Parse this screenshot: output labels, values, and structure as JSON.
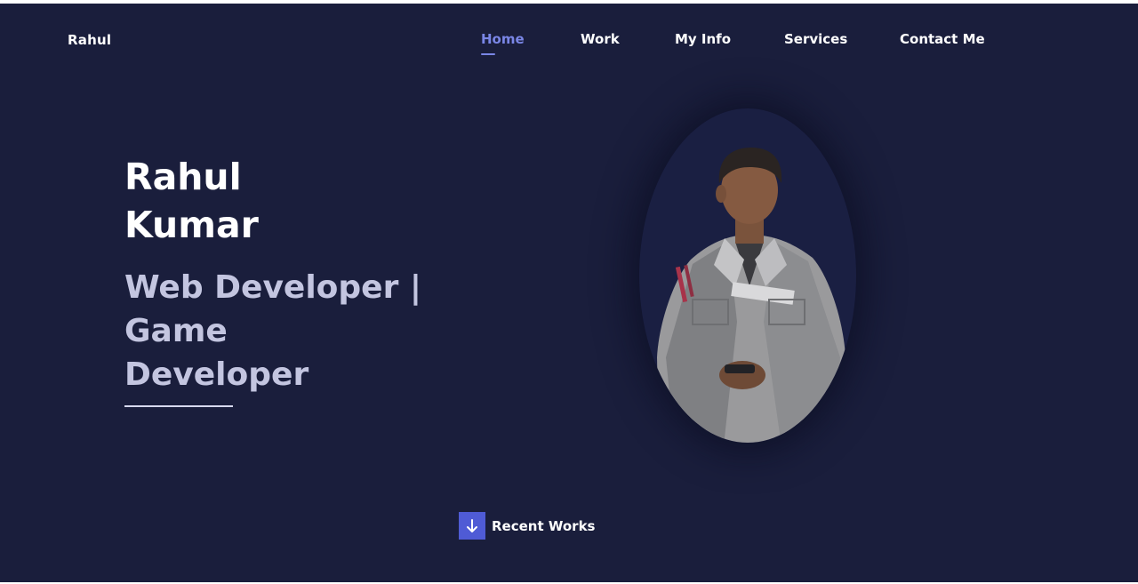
{
  "brand": {
    "logo": "Rahul"
  },
  "nav": {
    "items": [
      {
        "label": "Home",
        "active": true
      },
      {
        "label": "Work",
        "active": false
      },
      {
        "label": "My Info",
        "active": false
      },
      {
        "label": "Services",
        "active": false
      },
      {
        "label": "Contact Me",
        "active": false
      }
    ]
  },
  "hero": {
    "first_name": "Rahul",
    "last_name": "Kumar",
    "role_line1": "Web Developer |",
    "role_line2": "Game",
    "role_line3": "Developer"
  },
  "cta": {
    "label": "Recent Works",
    "icon": "arrow-down-icon"
  },
  "colors": {
    "background": "#1a1e3c",
    "accent": "#4f5bd5",
    "nav_active": "#7a86e6",
    "text": "#ffffff",
    "subtext": "#c3c5e0"
  }
}
